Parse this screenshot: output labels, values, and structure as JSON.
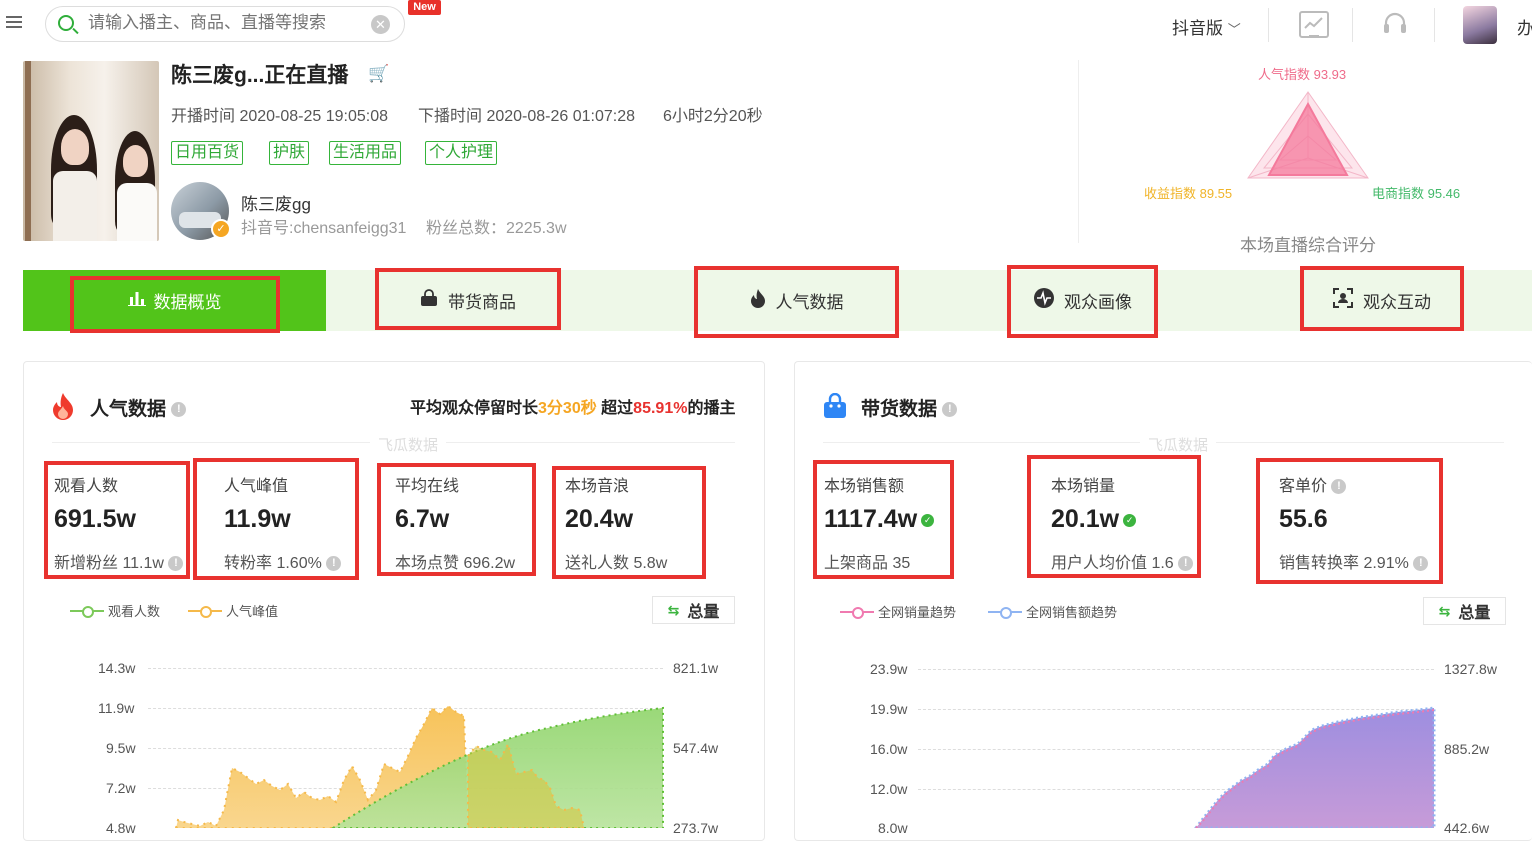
{
  "topbar": {
    "search_placeholder": "请输入播主、商品、直播等搜索",
    "new_badge": "New",
    "version_select": "抖音版",
    "user_name_trunc": "办"
  },
  "live": {
    "title": "陈三废g...正在直播",
    "start_time": "开播时间 2020-08-25 19:05:08",
    "end_time": "下播时间 2020-08-26 01:07:28",
    "duration": "6小时2分20秒",
    "tags": [
      "日用百货",
      "护肤",
      "生活用品",
      "个人护理"
    ],
    "anchor_name": "陈三废gg",
    "douyin_id": "抖音号:chensanfeigg31",
    "fans_total": "粉丝总数：2225.3w"
  },
  "radar": {
    "top_label": "人气指数 93.93",
    "left_label": "收益指数 89.55",
    "right_label": "电商指数 95.46",
    "caption": "本场直播综合评分",
    "values": {
      "popularity": 93.93,
      "revenue": 89.55,
      "ecommerce": 95.46
    },
    "colors": {
      "top": "#ef6b8a",
      "left": "#f0b429",
      "right": "#43b96a",
      "fill": "#f47a9c"
    }
  },
  "tabs": [
    {
      "label": "数据概览",
      "icon": "bar-chart-icon",
      "active": true
    },
    {
      "label": "带货商品",
      "icon": "shopping-bag-icon",
      "active": false
    },
    {
      "label": "人气数据",
      "icon": "flame-icon",
      "active": false
    },
    {
      "label": "观众画像",
      "icon": "pulse-icon",
      "active": false
    },
    {
      "label": "观众互动",
      "icon": "scan-face-icon",
      "active": false
    }
  ],
  "popularity": {
    "title": "人气数据",
    "summary_prefix": "平均观众停留时长",
    "summary_time": "3分30秒",
    "summary_mid": " 超过",
    "summary_pct": "85.91%",
    "summary_suffix": "的播主",
    "watermark": "飞瓜数据",
    "stats": [
      {
        "label": "观看人数",
        "value": "691.5w",
        "sub": "新增粉丝 11.1w"
      },
      {
        "label": "人气峰值",
        "value": "11.9w",
        "sub": "转粉率 1.60%"
      },
      {
        "label": "平均在线",
        "value": "6.7w",
        "sub": "本场点赞 696.2w"
      },
      {
        "label": "本场音浪",
        "value": "20.4w",
        "sub": "送礼人数 5.8w"
      }
    ],
    "legend": [
      "观看人数",
      "人气峰值"
    ],
    "total_label": "总量",
    "y_left_ticks": [
      "14.3w",
      "11.9w",
      "9.5w",
      "7.2w",
      "4.8w"
    ],
    "y_right_ticks": [
      "821.1w",
      "547.4w",
      "273.7w"
    ]
  },
  "sales": {
    "title": "带货数据",
    "watermark": "飞瓜数据",
    "stats": [
      {
        "label": "本场销售额",
        "value": "1117.4w",
        "sub": "上架商品 35",
        "verified": true
      },
      {
        "label": "本场销量",
        "value": "20.1w",
        "sub": "用户人均价值 1.6",
        "verified": true
      },
      {
        "label": "客单价",
        "value": "55.6",
        "sub": "销售转换率 2.91%"
      }
    ],
    "legend": [
      "全网销量趋势",
      "全网销售额趋势"
    ],
    "total_label": "总量",
    "y_left_ticks": [
      "23.9w",
      "19.9w",
      "16.0w",
      "12.0w",
      "8.0w"
    ],
    "y_right_ticks": [
      "1327.8w",
      "885.2w",
      "442.6w"
    ]
  },
  "colors": {
    "accent_green": "#52c41a",
    "highlight_red": "#e8322f",
    "viewers_green": "#7cc95a",
    "peak_orange": "#f5b94a",
    "sales_pink": "#f07ab0",
    "revenue_blue": "#8fb4f2"
  }
}
